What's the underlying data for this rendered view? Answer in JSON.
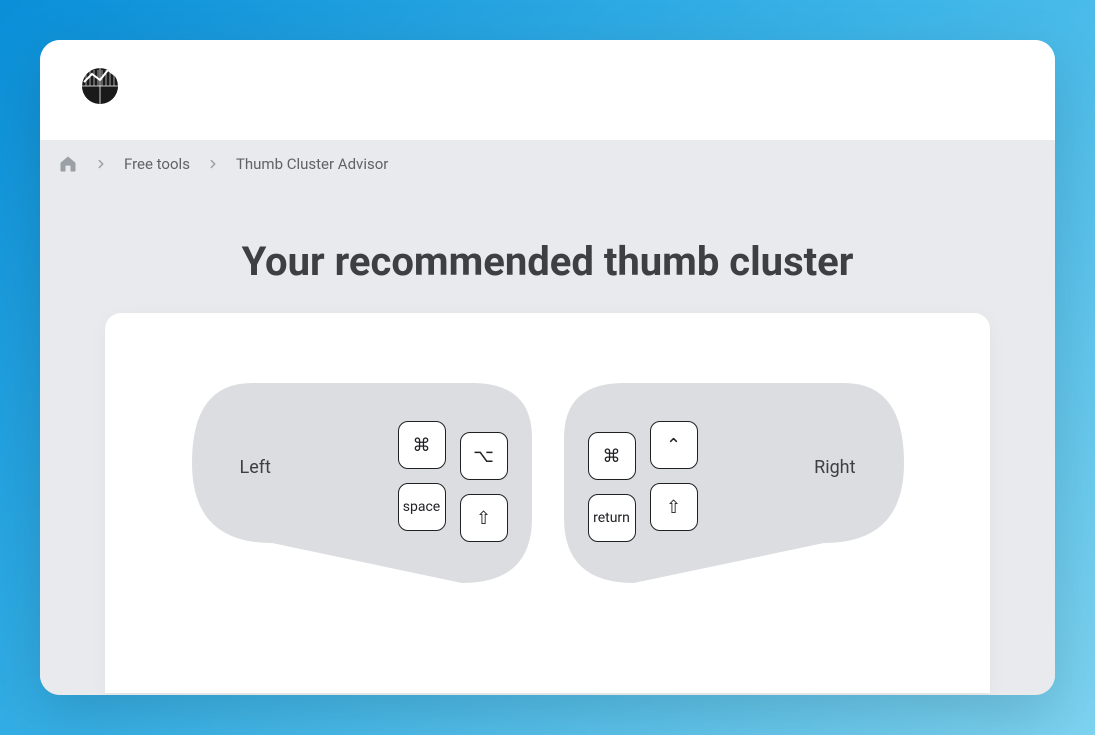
{
  "breadcrumb": {
    "home": "Home",
    "items": [
      "Free tools",
      "Thumb Cluster Advisor"
    ]
  },
  "page": {
    "heading": "Your recommended thumb cluster"
  },
  "clusters": {
    "left": {
      "label": "Left",
      "keys": {
        "topInner": "⌘",
        "topOuter": "⌥",
        "bottomInner": "space",
        "bottomOuter": "⇧"
      }
    },
    "right": {
      "label": "Right",
      "keys": {
        "topInner": "⌘",
        "topOuter": "⌃",
        "bottomInner": "return",
        "bottomOuter": "⇧"
      }
    }
  }
}
